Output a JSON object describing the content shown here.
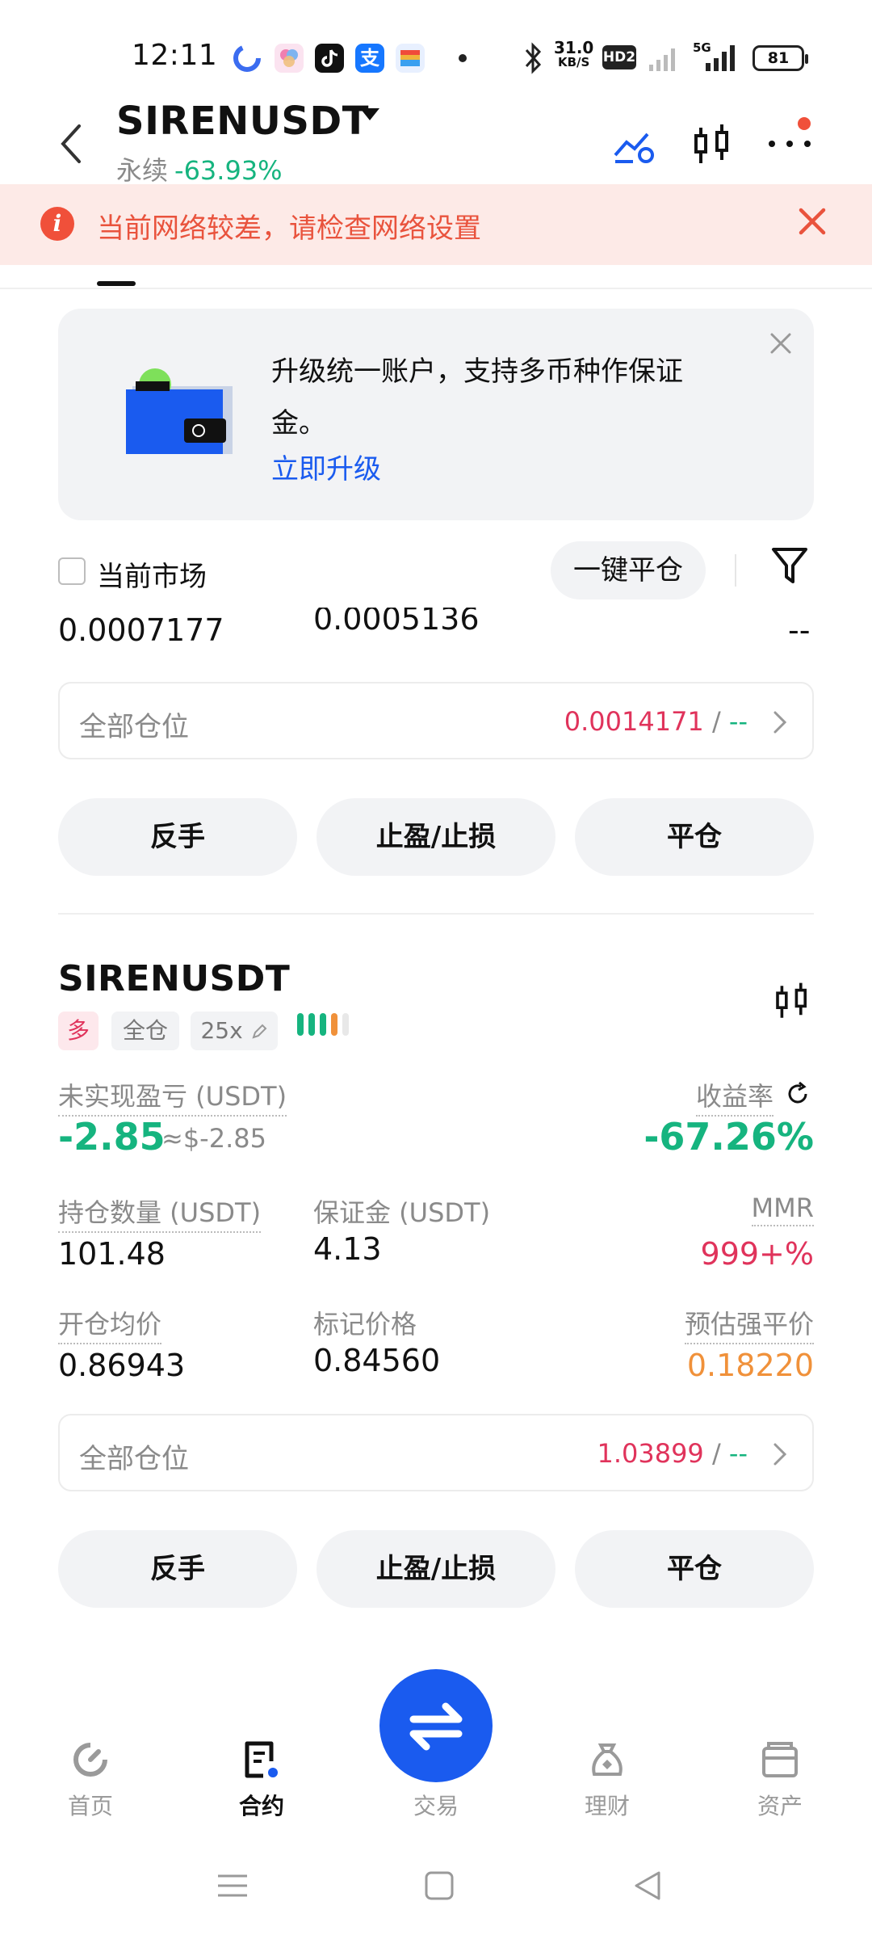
{
  "status_bar": {
    "time": "12:11",
    "net_speed_top": "31.0",
    "net_speed_bottom": "KB/S",
    "hd": "HD2",
    "network": "5G",
    "battery": "81"
  },
  "header": {
    "pair": "SIRENUSDT",
    "contract_type": "永续",
    "change": "-63.93%"
  },
  "network_warning": {
    "text": "当前网络较差，请检查网络设置"
  },
  "promo": {
    "text": "升级统一账户，支持多币种作保证金。",
    "link": "立即升级"
  },
  "filters": {
    "current_market": "当前市场",
    "close_all": "一键平仓"
  },
  "partial_values": {
    "left": "0.0007177",
    "middle": "0.0005136",
    "right": "--"
  },
  "positions_summary_1": {
    "label": "全部仓位",
    "value": "0.0014171",
    "separator": "/",
    "dash": "--"
  },
  "actions": {
    "reverse": "反手",
    "tpsl": "止盈/止损",
    "close": "平仓"
  },
  "position": {
    "symbol": "SIRENUSDT",
    "side": "多",
    "margin_mode": "全仓",
    "leverage": "25x",
    "unrealized_pnl_label": "未实现盈亏 (USDT)",
    "unrealized_pnl": "-2.85",
    "unrealized_pnl_usd": "≈$-2.85",
    "roi_label": "收益率",
    "roi": "-67.26%",
    "size_label": "持仓数量 (USDT)",
    "size": "101.48",
    "margin_label": "保证金 (USDT)",
    "margin": "4.13",
    "mmr_label": "MMR",
    "mmr": "999+%",
    "entry_label": "开仓均价",
    "entry": "0.86943",
    "mark_label": "标记价格",
    "mark": "0.84560",
    "liq_label": "预估强平价",
    "liq": "0.18220"
  },
  "positions_summary_2": {
    "label": "全部仓位",
    "value": "1.03899",
    "separator": "/",
    "dash": "--"
  },
  "bottom_nav": {
    "home": "首页",
    "futures": "合约",
    "trade": "交易",
    "earn": "理财",
    "assets": "资产"
  },
  "colors": {
    "green": "#16b47f",
    "red": "#e0335b",
    "orange": "#f0913a",
    "blue": "#1a5bef"
  }
}
